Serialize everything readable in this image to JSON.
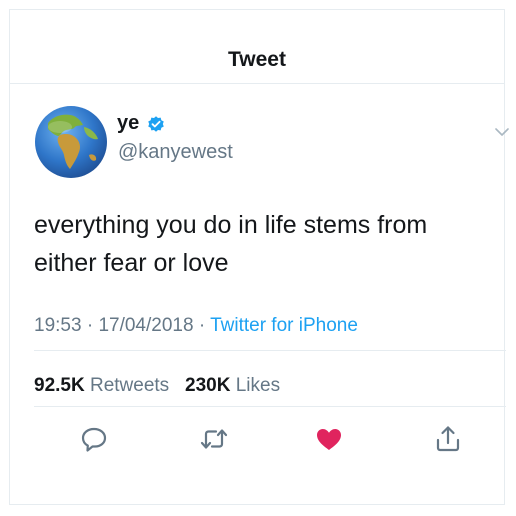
{
  "header": {
    "title": "Tweet"
  },
  "user": {
    "name": "ye",
    "handle": "@kanyewest",
    "verified": true
  },
  "tweet": {
    "text": "everything you do in life stems from either fear or love",
    "time": "19:53",
    "date": "17/04/2018",
    "source": "Twitter for iPhone"
  },
  "stats": {
    "retweets_count": "92.5K",
    "retweets_label": "Retweets",
    "likes_count": "230K",
    "likes_label": "Likes"
  },
  "actions": {
    "reply_icon": "reply-icon",
    "retweet_icon": "retweet-icon",
    "like_icon": "heart-icon",
    "share_icon": "share-icon",
    "liked": true
  },
  "colors": {
    "accent": "#1da1f2",
    "like": "#e0245e",
    "secondary_text": "#657786"
  }
}
